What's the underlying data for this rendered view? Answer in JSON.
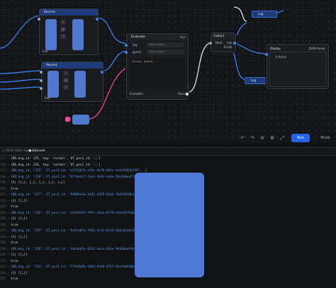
{
  "nodes": {
    "recent_top": {
      "title": "Recent",
      "footer": "Info"
    },
    "recent_bottom": {
      "title": "Recent",
      "footer": "Info"
    },
    "evaluate": {
      "title": "Evaluate",
      "badge": "f(x)",
      "inputs": [
        {
          "label": "arg",
          "placeholder": "Enter value..."
        },
        {
          "label": "guard",
          "placeholder": "Enter value..."
        }
      ],
      "code": "fn(arg, guard) ...",
      "footer": "Evaluator",
      "result_label": "Result"
    },
    "collect": {
      "title": "Collect",
      "row1": "Next",
      "row1_tag": "Coll",
      "row2": "Finish"
    },
    "display": {
      "title": "Display",
      "badge": "JSON Hover",
      "value": "0 items"
    },
    "log_top": "Log",
    "log_bottom": "Log"
  },
  "toolbar": {
    "undo": "↶",
    "redo": "↷",
    "zoom_out": "⊖",
    "zoom_in": "⊕",
    "fit": "⤢",
    "settings": "⚙",
    "run_label": "Run",
    "mode": "Mode"
  },
  "panel": {
    "tab1": "First-order replacer",
    "tab2": "Console"
  },
  "console": [
    {
      "n": "215",
      "arrow": "›",
      "text": "[DB_msg_id: 225, tag: 'normal', DT_pos1_id: '…']",
      "kind": "obj"
    },
    {
      "n": "216",
      "arrow": "›",
      "text": "[DB_msg_id: 226, tag: 'normal', DT_pos1_id: '…']",
      "kind": "obj"
    },
    {
      "n": "217",
      "arrow": "›",
      "text": "{DB_msg_id: \"225\", DT_pos1_id: \"e1f13b2d-c91c-4ef9-9b2c-eecb7b82bf59\", …}",
      "kind": "blue"
    },
    {
      "n": "218",
      "arrow": "›",
      "text": "{DB_msg_id: \"226\", DT_pos1_id: \"6f7eb2cf-13e2-4a94-ac9e-5dcda8ea7f80\", …}",
      "kind": "blue"
    },
    {
      "n": "219",
      "arrow": "›",
      "text": "(5) [{…}, {…}, {…}, {…}, {…}]",
      "kind": "obj"
    },
    {
      "n": "220",
      "arrow": "",
      "text": "true",
      "kind": "plain"
    },
    {
      "n": "221",
      "arrow": "›",
      "text": "{DB_msg_id: \"227\", DT_pos1_id: \"9d09ba3a-14d2-4329-82a3-7bd25010b1f2\", …}",
      "kind": "blue"
    },
    {
      "n": "222",
      "arrow": "›",
      "text": "(1) [{…}]",
      "kind": "obj"
    },
    {
      "n": "223",
      "arrow": "",
      "text": "true",
      "kind": "plain"
    },
    {
      "n": "224",
      "arrow": "›",
      "text": "{DB_msg_id: \"228\", DT_pos1_id: \"2d159425-f9fe-42ea-8779-15ee56f92ba5\", …}",
      "kind": "blue"
    },
    {
      "n": "225",
      "arrow": "›",
      "text": "(1) [{…}]",
      "kind": "obj"
    },
    {
      "n": "226",
      "arrow": "",
      "text": "true",
      "kind": "plain"
    },
    {
      "n": "227",
      "arrow": "›",
      "text": "{DB_msg_id: \"229\", DT_pos1_id: \"6c9ca85a-79d2-4c11-9c33-4b0c62a4c329\", …}",
      "kind": "blue"
    },
    {
      "n": "228",
      "arrow": "›",
      "text": "(1) [{…}]",
      "kind": "obj"
    },
    {
      "n": "229",
      "arrow": "",
      "text": "true",
      "kind": "plain"
    },
    {
      "n": "230",
      "arrow": "›",
      "text": "{DB_msg_id: \"230\", DT_pos1_id: \"1dcdeb5e-b531-4ece-b54e-9d4d0eaf4e7d\", …}",
      "kind": "blue"
    },
    {
      "n": "231",
      "arrow": "›",
      "text": "(1) [{…}]",
      "kind": "obj"
    },
    {
      "n": "232",
      "arrow": "",
      "text": "true",
      "kind": "plain"
    },
    {
      "n": "233",
      "arrow": "›",
      "text": "{DB_msg_id: \"231\", DT_pos1_id: \"ff944a9e-c8d3-4a49-b7b7-84afa6630eab\", …}",
      "kind": "blue"
    },
    {
      "n": "234",
      "arrow": "›",
      "text": "(1) [{…}]",
      "kind": "obj"
    },
    {
      "n": "235",
      "arrow": "",
      "text": "true",
      "kind": "plain"
    }
  ],
  "colors": {
    "accent": "#2563eb",
    "node_header": "#1f3a78",
    "slot_blue": "#5078cf",
    "wire_blue": "#3b82f6",
    "wire_white": "#e5e7eb",
    "wire_pink": "#ec4899"
  }
}
